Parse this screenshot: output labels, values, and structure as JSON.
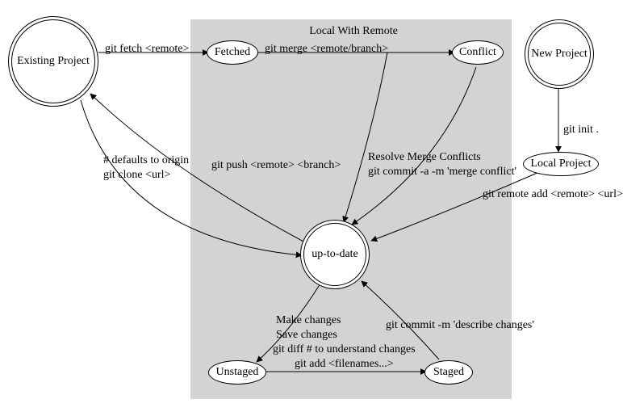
{
  "chart_data": {
    "type": "state-diagram",
    "title": "Git workflow state diagram",
    "cluster": {
      "label": "Local With Remote"
    },
    "nodes": [
      {
        "id": "existing",
        "label": "Existing Project",
        "doublecircle": true,
        "in_cluster": false
      },
      {
        "id": "new",
        "label": "New Project",
        "doublecircle": true,
        "in_cluster": false
      },
      {
        "id": "localproj",
        "label": "Local Project",
        "doublecircle": false,
        "in_cluster": false
      },
      {
        "id": "fetched",
        "label": "Fetched",
        "doublecircle": false,
        "in_cluster": true
      },
      {
        "id": "conflict",
        "label": "Conflict",
        "doublecircle": false,
        "in_cluster": true
      },
      {
        "id": "uptodate",
        "label": "up-to-date",
        "doublecircle": true,
        "in_cluster": true
      },
      {
        "id": "unstaged",
        "label": "Unstaged",
        "doublecircle": false,
        "in_cluster": true
      },
      {
        "id": "staged",
        "label": "Staged",
        "doublecircle": false,
        "in_cluster": true
      }
    ],
    "edges": [
      {
        "from": "existing",
        "to": "fetched",
        "label": "git fetch <remote>"
      },
      {
        "from": "fetched",
        "to": "conflict",
        "label": "git merge <remote/branch>"
      },
      {
        "from": "fetched",
        "to": "uptodate",
        "label": ""
      },
      {
        "from": "conflict",
        "to": "uptodate",
        "label": "Resolve Merge Conflicts\ngit commit -a -m 'merge conflict'"
      },
      {
        "from": "uptodate",
        "to": "existing",
        "label": "git push <remote> <branch>"
      },
      {
        "from": "existing",
        "to": "uptodate",
        "label": "# defaults to origin\ngit clone <url>"
      },
      {
        "from": "uptodate",
        "to": "unstaged",
        "label": "Make changes\nSave changes"
      },
      {
        "from": "unstaged",
        "to": "staged",
        "label": "git diff # to understand changes\ngit add <filenames...>"
      },
      {
        "from": "staged",
        "to": "uptodate",
        "label": "git commit -m 'describe changes'"
      },
      {
        "from": "new",
        "to": "localproj",
        "label": "git init ."
      },
      {
        "from": "localproj",
        "to": "uptodate",
        "label": "git remote add <remote> <url>"
      }
    ]
  },
  "region": {
    "title": "Local With Remote"
  },
  "nodes": {
    "existing": "Existing Project",
    "new": "New Project",
    "localproj": "Local Project",
    "fetched": "Fetched",
    "conflict": "Conflict",
    "uptodate": "up-to-date",
    "unstaged": "Unstaged",
    "staged": "Staged"
  },
  "edgelabels": {
    "e_fetch": "git fetch <remote>",
    "e_merge": "git merge <remote/branch>",
    "e_resolve": "Resolve Merge Conflicts\ngit commit -a -m 'merge conflict'",
    "e_push": "git push <remote> <branch>",
    "e_clone": "# defaults to origin\ngit clone <url>",
    "e_make": "Make changes\nSave changes",
    "e_add": "git diff # to understand changes\ngit add <filenames...>",
    "e_commit": "git commit -m 'describe changes'",
    "e_init": "git init .",
    "e_remote": "git remote add <remote> <url>"
  }
}
